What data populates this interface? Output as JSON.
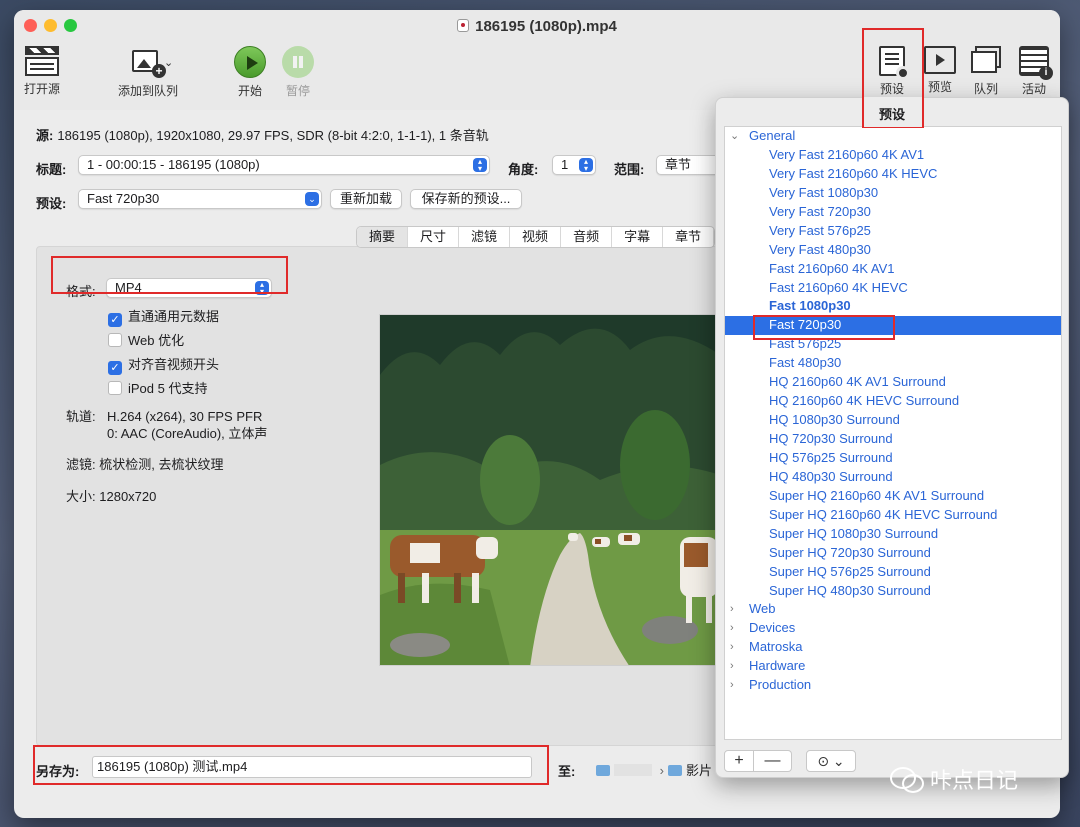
{
  "window": {
    "title": "186195 (1080p).mp4"
  },
  "toolbar": {
    "open_source": "打开源",
    "add_to_queue": "添加到队列",
    "start": "开始",
    "pause": "暂停",
    "presets": "预设",
    "preview": "预览",
    "queue": "队列",
    "activity": "活动",
    "presets_tooltip": "预设"
  },
  "source": {
    "label": "源:",
    "value": "186195 (1080p), 1920x1080, 29.97 FPS, SDR (8-bit 4:2:0, 1-1-1), 1 条音轨"
  },
  "title_row": {
    "label": "标题:",
    "value": "1 - 00:00:15 - 186195 (1080p)",
    "angle_label": "角度:",
    "angle_value": "1",
    "range_label": "范围:",
    "range_value": "章节"
  },
  "preset_row": {
    "label": "预设:",
    "value": "Fast 720p30",
    "reload": "重新加载",
    "save_new": "保存新的预设..."
  },
  "tabs": [
    "摘要",
    "尺寸",
    "滤镜",
    "视频",
    "音频",
    "字幕",
    "章节"
  ],
  "summary": {
    "format_label": "格式:",
    "format_value": "MP4",
    "options": [
      {
        "label": "直通通用元数据",
        "checked": true
      },
      {
        "label": "Web 优化",
        "checked": false
      },
      {
        "label": "对齐音视频开头",
        "checked": true
      },
      {
        "label": "iPod 5 代支持",
        "checked": false
      }
    ],
    "tracks_label": "轨道:",
    "tracks_line1": "H.264 (x264), 30 FPS PFR",
    "tracks_line2": "0: AAC (CoreAudio), 立体声",
    "filters_label": "滤镜:",
    "filters_value": "梳状检测, 去梳状纹理",
    "size_label": "大小:",
    "size_value": "1280x720"
  },
  "save": {
    "label": "另存为:",
    "value": "186195 (1080p) 测试.mp4",
    "dest_label": "至:",
    "dest_folder": "影片"
  },
  "presets_popover": {
    "groups": [
      {
        "name": "General",
        "expanded": true,
        "items": [
          "Very Fast 2160p60 4K AV1",
          "Very Fast 2160p60 4K HEVC",
          "Very Fast 1080p30",
          "Very Fast 720p30",
          "Very Fast 576p25",
          "Very Fast 480p30",
          "Fast 2160p60 4K AV1",
          "Fast 2160p60 4K HEVC",
          "Fast 1080p30",
          "Fast 720p30",
          "Fast 576p25",
          "Fast 480p30",
          "HQ 2160p60 4K AV1 Surround",
          "HQ 2160p60 4K HEVC Surround",
          "HQ 1080p30 Surround",
          "HQ 720p30 Surround",
          "HQ 576p25 Surround",
          "HQ 480p30 Surround",
          "Super HQ 2160p60 4K AV1 Surround",
          "Super HQ 2160p60 4K HEVC Surround",
          "Super HQ 1080p30 Surround",
          "Super HQ 720p30 Surround",
          "Super HQ 576p25 Surround",
          "Super HQ 480p30 Surround"
        ],
        "default_item": "Fast 1080p30",
        "selected_item": "Fast 720p30"
      },
      {
        "name": "Web",
        "expanded": false
      },
      {
        "name": "Devices",
        "expanded": false
      },
      {
        "name": "Matroska",
        "expanded": false
      },
      {
        "name": "Hardware",
        "expanded": false
      },
      {
        "name": "Production",
        "expanded": false
      }
    ],
    "footer": {
      "add": "+",
      "remove": "—",
      "more": "⊙ ⌄"
    }
  },
  "watermark": "咔点日记",
  "colors": {
    "accent": "#2c6fe4",
    "link_text": "#2a65d6",
    "highlight_box": "#e02a2a"
  }
}
